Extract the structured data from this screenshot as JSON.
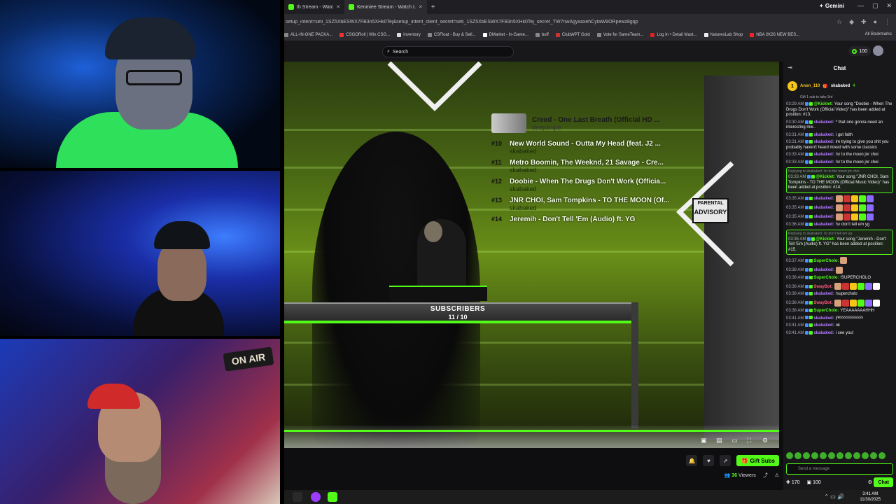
{
  "browser": {
    "tabs": [
      {
        "label": "th Stream - Watc",
        "active": false
      },
      {
        "label": "Kenmiee Stream - Watch L",
        "active": true
      }
    ],
    "gemini_label": "Gemini",
    "url": "setup_intent=seti_1SZ5XbESWX7FB3n5XHk0Tej&setup_intent_client_secret=seti_1SZ5XbESWX7FB3n5XHk0Tej_secret_TW7nwAgyxaxehCytaW9ORpewz8gqp",
    "bookmarks": [
      "ALL-IN-ONE PACKA...",
      "CSGORoll | Win CSG...",
      "Inventory",
      "CSFloat - Buy & Sell...",
      "DMarket - In-Game...",
      "buff",
      "ClubWPT Gold",
      "Vote for SameTeam...",
      "Log In • Detail Mast...",
      "NaturesLab Shop",
      "NBA 2K26 NEW BES..."
    ],
    "all_bookmarks": "All Bookmarks"
  },
  "site": {
    "search_placeholder": "Search",
    "points": "100"
  },
  "overlay": {
    "now_playing": {
      "title": "Creed - One Last Breath (Official HD ...",
      "user": "deepsnipe"
    },
    "queue": [
      {
        "pos": "#10",
        "title": "New World Sound - Outta My Head (feat. J2 ...",
        "user": "skabaked"
      },
      {
        "pos": "#11",
        "title": "Metro Boomin, The Weeknd, 21 Savage - Cre...",
        "user": "skabaked"
      },
      {
        "pos": "#12",
        "title": "Doobie - When The Drugs Don't Work (Officia...",
        "user": "skabaked"
      },
      {
        "pos": "#13",
        "title": "JNR CHOI, Sam Tompkins - TO THE MOON (Of...",
        "user": "skabaked"
      },
      {
        "pos": "#14",
        "title": "Jeremih - Don't Tell 'Em (Audio) ft. YG",
        "user": ""
      }
    ],
    "subs_label": "SUBSCRIBERS",
    "subs_count": "11 / 10",
    "subs_progress": 1.0,
    "advisory_top": "PARENTAL",
    "advisory_mid": "ADVISORY",
    "onair": "ON AIR"
  },
  "actions": {
    "gift_subs": "Gift Subs",
    "viewers_count": "36",
    "viewers_label": "Viewers"
  },
  "chat": {
    "title": "Chat",
    "pinned_user": "Anon_110",
    "pinned_user2": "skabaked",
    "pinned_count": "4",
    "pinned_sub": "Gift 1 sub to take 3rd",
    "messages": [
      {
        "time": "03:29 AM",
        "user": "@Kicklet:",
        "user_color": "#53fc18",
        "text": "Your song \"Doobie - When The Drugs Don't Work (Official Video)\" has been added at position: #13.",
        "highlight": false,
        "reply": ""
      },
      {
        "time": "03:30 AM",
        "user": "skabaked:",
        "user_color": "#b37bff",
        "text": "* that one gonna need an interesting mix..",
        "highlight": false,
        "reply": ""
      },
      {
        "time": "03:31 AM",
        "user": "skabaked:",
        "user_color": "#b37bff",
        "text": "i got faith",
        "highlight": false,
        "reply": ""
      },
      {
        "time": "03:31 AM",
        "user": "skabaked:",
        "user_color": "#b37bff",
        "text": "im trying to give you shit you probably haven't heard mixed with some classics",
        "highlight": false,
        "reply": ""
      },
      {
        "time": "03:33 AM",
        "user": "skabaked:",
        "user_color": "#b37bff",
        "text": "!sr to the moon jnr choi",
        "highlight": false,
        "reply": ""
      },
      {
        "time": "03:33 AM",
        "user": "skabaked:",
        "user_color": "#b37bff",
        "text": "!sr to the moon jnr choi",
        "highlight": false,
        "reply": ""
      },
      {
        "time": "03:33 AM",
        "user": "@Kicklet:",
        "user_color": "#53fc18",
        "text": "Your song \"JNR CHOI, Sam Tompkins - TO THE MOON (Official Music Video)\" has been added at position: #14.",
        "highlight": true,
        "reply": "Replying to skabaked: !sr to the moon jnr choi"
      },
      {
        "time": "03:35 AM",
        "user": "skabaked:",
        "user_color": "#b37bff",
        "text": "",
        "highlight": false,
        "reply": "",
        "emotes": 5
      },
      {
        "time": "03:35 AM",
        "user": "skabaked:",
        "user_color": "#b37bff",
        "text": "",
        "highlight": false,
        "reply": "",
        "emotes": 5
      },
      {
        "time": "03:35 AM",
        "user": "skabaked:",
        "user_color": "#b37bff",
        "text": "",
        "highlight": false,
        "reply": "",
        "emotes": 5
      },
      {
        "time": "03:36 AM",
        "user": "skabaked:",
        "user_color": "#b37bff",
        "text": "!sr don't tell em yg",
        "highlight": false,
        "reply": ""
      },
      {
        "time": "03:36 AM",
        "user": "@Kicklet:",
        "user_color": "#53fc18",
        "text": "Your song \"Jeremih - Don't Tell 'Em (Audio) ft. YG\" has been added at position: #15.",
        "highlight": true,
        "reply": "Replying to skabaked: !sr don't tell em yg"
      },
      {
        "time": "03:37 AM",
        "user": "SuperCholo:",
        "user_color": "#53fc18",
        "text": "",
        "highlight": false,
        "reply": "",
        "emotes": 1
      },
      {
        "time": "03:38 AM",
        "user": "skabaked:",
        "user_color": "#b37bff",
        "text": "",
        "highlight": false,
        "reply": "",
        "emotes": 1
      },
      {
        "time": "03:38 AM",
        "user": "SuperCholo:",
        "user_color": "#53fc18",
        "text": "!SUPERCHOLO",
        "highlight": false,
        "reply": ""
      },
      {
        "time": "03:38 AM",
        "user": "SwayBot:",
        "user_color": "#ff5a7a",
        "text": "",
        "highlight": false,
        "reply": "",
        "emotes": 6
      },
      {
        "time": "03:38 AM",
        "user": "skabaked:",
        "user_color": "#b37bff",
        "text": "!supercholo",
        "highlight": false,
        "reply": ""
      },
      {
        "time": "03:38 AM",
        "user": "SwayBot:",
        "user_color": "#ff5a7a",
        "text": "",
        "highlight": false,
        "reply": "",
        "emotes": 6
      },
      {
        "time": "03:38 AM",
        "user": "SuperCholo:",
        "user_color": "#53fc18",
        "text": "YEAAAAAAAHHH",
        "highlight": false,
        "reply": ""
      },
      {
        "time": "03:41 AM",
        "user": "skabaked:",
        "user_color": "#b37bff",
        "text": "yesssssssssss",
        "highlight": false,
        "reply": ""
      },
      {
        "time": "03:41 AM",
        "user": "skabaked:",
        "user_color": "#b37bff",
        "text": "ok",
        "highlight": false,
        "reply": ""
      },
      {
        "time": "03:41 AM",
        "user": "skabaked:",
        "user_color": "#b37bff",
        "text": "i see you!",
        "highlight": false,
        "reply": ""
      }
    ],
    "input_placeholder": "Send a message",
    "points_a": "170",
    "points_b": "100",
    "send_label": "Chat"
  },
  "taskbar": {
    "time": "3:41 AM",
    "date": "11/30/2025"
  },
  "colors": {
    "accent": "#53fc18",
    "chat_bg": "#18181b",
    "page_bg": "#0e0e10"
  }
}
